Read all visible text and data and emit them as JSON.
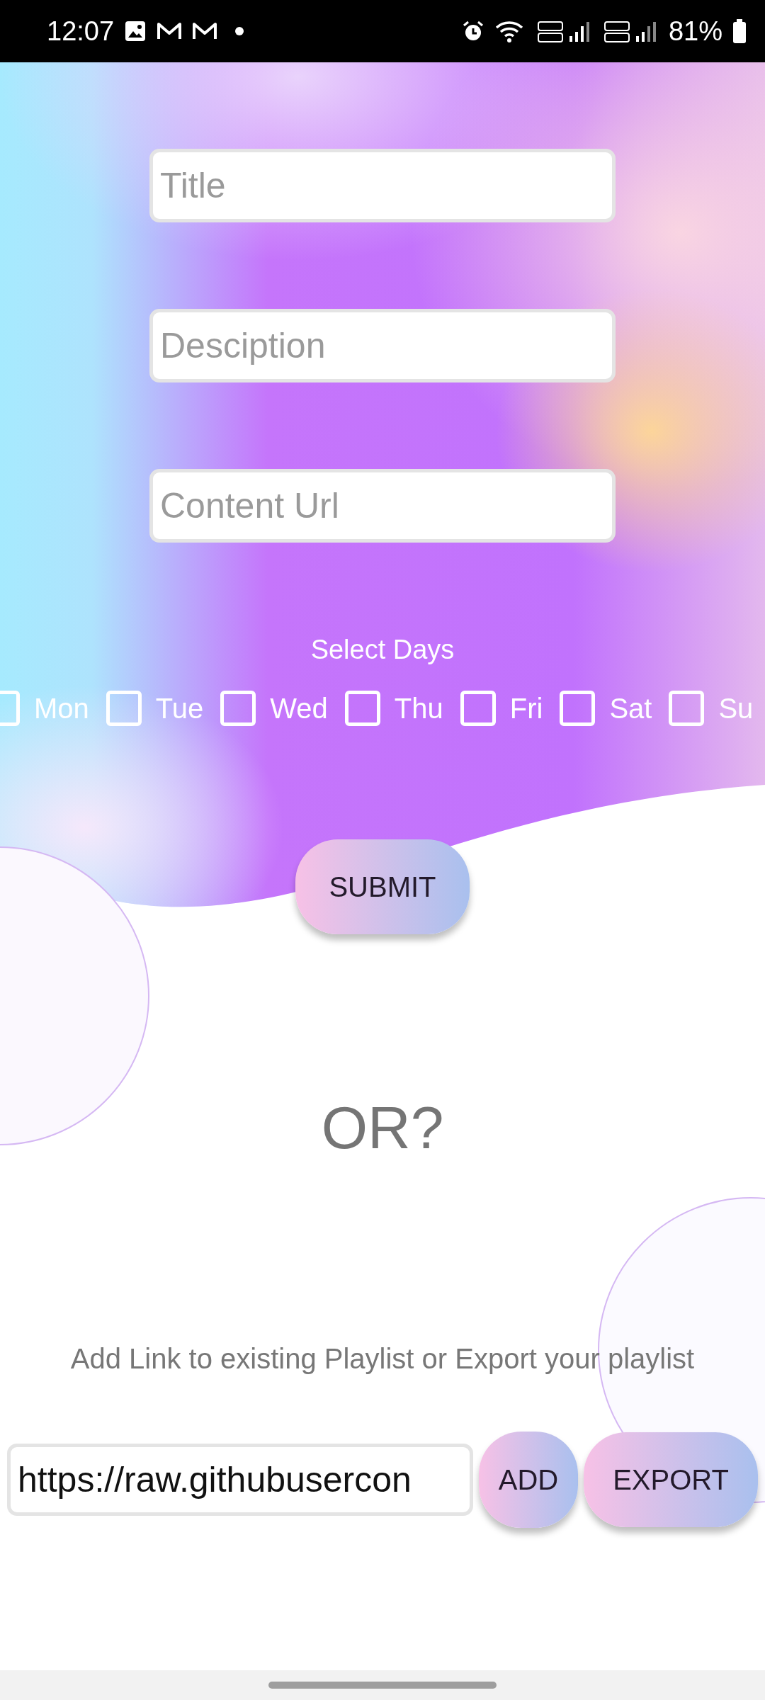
{
  "status_bar": {
    "time": "12:07",
    "battery": "81%"
  },
  "form": {
    "fields": [
      {
        "placeholder": "Title"
      },
      {
        "placeholder": "Desciption"
      },
      {
        "placeholder": "Content Url"
      }
    ],
    "days_label": "Select Days",
    "days": [
      {
        "label": "Mon",
        "checked": false
      },
      {
        "label": "Tue",
        "checked": false
      },
      {
        "label": "Wed",
        "checked": false
      },
      {
        "label": "Thu",
        "checked": false
      },
      {
        "label": "Fri",
        "checked": false
      },
      {
        "label": "Sat",
        "checked": false
      },
      {
        "label": "Su",
        "checked": false
      }
    ],
    "submit": "SUBMIT"
  },
  "divider_text": "OR?",
  "playlist": {
    "caption": "Add Link to existing Playlist or Export your playlist",
    "link_value": "https://raw.githubusercon",
    "add": "ADD",
    "export": "EXPORT"
  }
}
